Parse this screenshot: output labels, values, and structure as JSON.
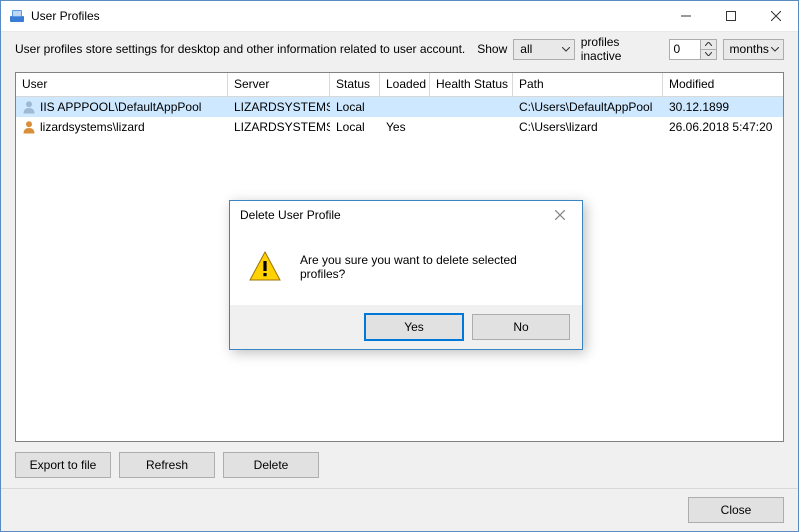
{
  "window": {
    "title": "User Profiles"
  },
  "toolbar": {
    "description": "User profiles store settings for desktop and other information related to user account.",
    "show_label": "Show",
    "show_value": "all",
    "inactive_label": "profiles inactive",
    "inactive_value": "0",
    "period_value": "months"
  },
  "grid": {
    "headers": {
      "user": "User",
      "server": "Server",
      "status": "Status",
      "loaded": "Loaded",
      "health": "Health Status",
      "path": "Path",
      "modified": "Modified"
    },
    "rows": [
      {
        "selected": true,
        "icon_color": "#9eb9d4",
        "user": "IIS APPPOOL\\DefaultAppPool",
        "server": "LIZARDSYSTEMS",
        "status": "Local",
        "loaded": "",
        "health": "",
        "path": "C:\\Users\\DefaultAppPool",
        "modified": "30.12.1899"
      },
      {
        "selected": false,
        "icon_color": "#d98f3a",
        "user": "lizardsystems\\lizard",
        "server": "LIZARDSYSTEMS",
        "status": "Local",
        "loaded": "Yes",
        "health": "",
        "path": "C:\\Users\\lizard",
        "modified": "26.06.2018 5:47:20"
      }
    ]
  },
  "buttons": {
    "export": "Export to file",
    "refresh": "Refresh",
    "delete": "Delete",
    "close": "Close"
  },
  "dialog": {
    "title": "Delete User Profile",
    "message": "Are you sure you want to delete selected profiles?",
    "yes": "Yes",
    "no": "No"
  }
}
